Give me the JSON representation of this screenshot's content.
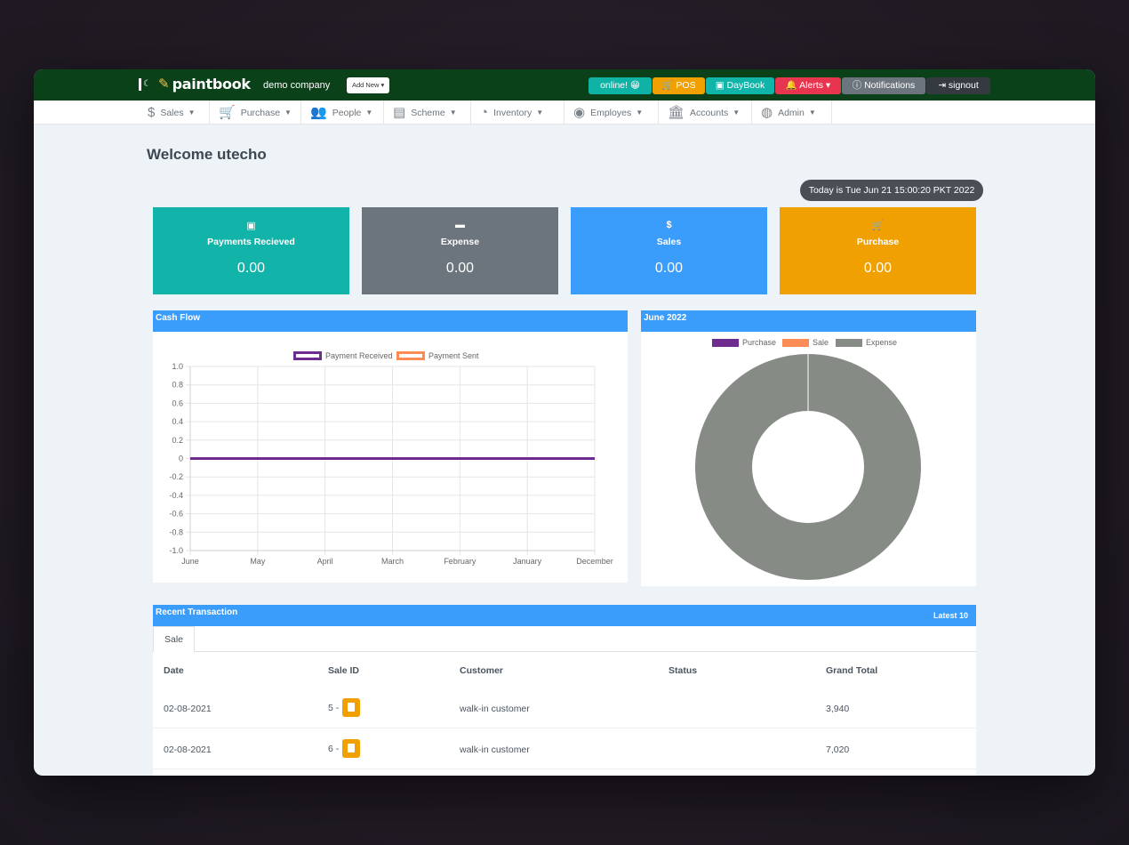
{
  "header": {
    "logo_text": "paintbook",
    "company": "demo company",
    "add_new": "Add New ▾",
    "buttons": {
      "online": "online! 😁",
      "pos": "🛒 POS",
      "daybook": "▣ DayBook",
      "alerts": "🔔 Alerts ▾",
      "notifications": "ⓘ Notifications",
      "signout": "⇥ signout"
    }
  },
  "nav": {
    "items": [
      {
        "label": "Sales",
        "icon": "$"
      },
      {
        "label": "Purchase",
        "icon": "🛒"
      },
      {
        "label": "People",
        "icon": "👥"
      },
      {
        "label": "Scheme",
        "icon": "▤"
      },
      {
        "label": "Inventory",
        "icon": "◔"
      },
      {
        "label": "Employes",
        "icon": "◉"
      },
      {
        "label": "Accounts",
        "icon": "🏛"
      },
      {
        "label": "Admin",
        "icon": "◍"
      }
    ]
  },
  "welcome": "Welcome utecho",
  "today": "Today is Tue Jun 21 15:00:20 PKT 2022",
  "cards": [
    {
      "icon": "▣",
      "label": "Payments Recieved",
      "value": "0.00",
      "color": "#12b3a8"
    },
    {
      "icon": "▬",
      "label": "Expense",
      "value": "0.00",
      "color": "#6c757d"
    },
    {
      "icon": "$",
      "label": "Sales",
      "value": "0.00",
      "color": "#3a9cfb"
    },
    {
      "icon": "🛒",
      "label": "Purchase",
      "value": "0.00",
      "color": "#f0a000"
    }
  ],
  "cashflow": {
    "title": "Cash Flow",
    "chart_data": {
      "type": "line",
      "title": "",
      "xlabel": "",
      "ylabel": "",
      "categories": [
        "June",
        "May",
        "April",
        "March",
        "February",
        "January",
        "December"
      ],
      "ylim": [
        -1.0,
        1.0
      ],
      "yticks": [
        "1.0",
        "0.8",
        "0.6",
        "0.4",
        "0.2",
        "0",
        "-0.2",
        "-0.4",
        "-0.6",
        "-0.8",
        "-1.0"
      ],
      "grid": true,
      "legend": "top",
      "series": [
        {
          "name": "Payment Received",
          "values": [
            0,
            0,
            0,
            0,
            0,
            0,
            0
          ],
          "color": "#6f2c8f"
        },
        {
          "name": "Payment Sent",
          "values": [
            0,
            0,
            0,
            0,
            0,
            0,
            0
          ],
          "color": "#fb8c55"
        }
      ]
    }
  },
  "june": {
    "title": "June 2022",
    "chart_data": {
      "type": "pie",
      "title": "",
      "legend": "top",
      "categories": [
        "Purchase",
        "Sale",
        "Expense"
      ],
      "values": [
        0,
        0,
        100
      ],
      "colors": [
        "#6f2c8f",
        "#fb8c55",
        "#868b85"
      ]
    }
  },
  "recent": {
    "title": "Recent Transaction",
    "latest": "Latest 10",
    "tab": "Sale",
    "columns": [
      "Date",
      "Sale ID",
      "Customer",
      "Status",
      "Grand Total"
    ],
    "rows": [
      {
        "date": "02-08-2021",
        "sale_id": "5 -",
        "customer": "walk-in customer",
        "status": "",
        "total": "3,940"
      },
      {
        "date": "02-08-2021",
        "sale_id": "6 -",
        "customer": "walk-in customer",
        "status": "",
        "total": "7,020"
      }
    ]
  }
}
